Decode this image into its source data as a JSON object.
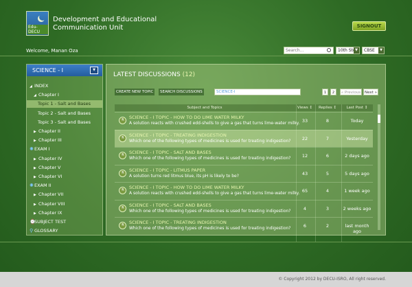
{
  "header": {
    "logo_text": "Edu-DECU",
    "title_line1": "Development and Educational",
    "title_line2": "Communication Unit",
    "signout_label": "SIGNOUT"
  },
  "topbar": {
    "welcome": "Welcome, Manan Oza",
    "search_placeholder": "Search...",
    "std_value": "10th Std",
    "board_value": "CBSE"
  },
  "sidebar": {
    "title": "SCIENCE - I",
    "items": [
      {
        "label": "INDEX",
        "level": 0,
        "icon": "triangle-down",
        "selected": false
      },
      {
        "label": "Chapter I",
        "level": 1,
        "icon": "triangle-down",
        "selected": false
      },
      {
        "label": "Topic 1 - Salt and Bases",
        "level": 2,
        "icon": "",
        "selected": true
      },
      {
        "label": "Topic 2 - Salt and Bases",
        "level": 2,
        "icon": "",
        "selected": false
      },
      {
        "label": "Topic 3 - Salt and Bases",
        "level": 2,
        "icon": "",
        "selected": false
      },
      {
        "label": "Chapter II",
        "level": 1,
        "icon": "triangle-right",
        "selected": false
      },
      {
        "label": "Chapter III",
        "level": 1,
        "icon": "triangle-right",
        "selected": false
      },
      {
        "label": "EXAM I",
        "level": 0,
        "icon": "sun",
        "selected": false
      },
      {
        "label": "Chapter IV",
        "level": 1,
        "icon": "triangle-right",
        "selected": false
      },
      {
        "label": "Chapter V",
        "level": 1,
        "icon": "triangle-right",
        "selected": false
      },
      {
        "label": "Chapter VI",
        "level": 1,
        "icon": "triangle-right",
        "selected": false
      },
      {
        "label": "EXAM II",
        "level": 0,
        "icon": "sun",
        "selected": false
      },
      {
        "label": "Chapter VII",
        "level": 1,
        "icon": "triangle-right",
        "selected": false
      },
      {
        "label": "Chapter VIII",
        "level": 1,
        "icon": "triangle-right",
        "selected": false
      },
      {
        "label": "Chapter IX",
        "level": 1,
        "icon": "triangle-right",
        "selected": false
      },
      {
        "label": "SUBJECT TEST",
        "level": 0,
        "icon": "clock",
        "selected": false
      },
      {
        "label": "GLOSSARY",
        "level": 0,
        "icon": "magnifier",
        "selected": false
      }
    ]
  },
  "main": {
    "title": "LATEST DISCUSSIONS",
    "count": "(12)",
    "create_label": "CREATE NEW TOPIC",
    "search_label": "SEARCH DISCUSSIONS",
    "search_value": "SCIENCE-I",
    "pages": [
      "1",
      "2"
    ],
    "prev_label": "« Previous",
    "next_label": "Next »",
    "columns": [
      "Subject and Topics",
      "Views ↕",
      "Replies ↕",
      "Last Post ↕"
    ],
    "rows": [
      {
        "title": "SCIENCE - I   TOPIC - HOW TO DO LIME WATER MILKY",
        "desc": "A solution reacts with crushed edd-shells to give a gas that turns lime-water milky.",
        "views": "33",
        "replies": "8",
        "last": "Today",
        "highlight": false
      },
      {
        "title": "SCIENCE - I   TOPIC - TREATING INDIGESTION",
        "desc": "Which one of the following types of medicines is used for treating indigestion?",
        "views": "22",
        "replies": "7",
        "last": "Yesterday",
        "highlight": true
      },
      {
        "title": "SCIENCE - I   TOPIC - SALT AND BASES",
        "desc": "Which one of the following types of medicines is used for treating indigestion?",
        "views": "12",
        "replies": "6",
        "last": "2 days ago",
        "highlight": false
      },
      {
        "title": "SCIENCE - I   TOPIC - LITMUS PAPER",
        "desc": "A solution turns red litmus blue, its pH is likely to be?",
        "views": "43",
        "replies": "5",
        "last": "5 days ago",
        "highlight": false
      },
      {
        "title": "SCIENCE - I   TOPIC - HOW TO DO LIME WATER MILKY",
        "desc": "A solution reacts with crushed edd-shells to give a gas that turns lime-water milky.",
        "views": "65",
        "replies": "4",
        "last": "1 week ago",
        "highlight": false
      },
      {
        "title": "SCIENCE - I   TOPIC - SALT AND BASES",
        "desc": "Which one of the following types of medicines is used for treating indigestion?",
        "views": "4",
        "replies": "3",
        "last": "2 weeks ago",
        "highlight": false
      },
      {
        "title": "SCIENCE - I   TOPIC - TREATING INDIGESTION",
        "desc": "Which one of the following types of medicines is used for treating indigestion?",
        "views": "6",
        "replies": "2",
        "last": "last month ago",
        "highlight": false
      }
    ]
  },
  "footer": {
    "copyright": "© Copyright 2012 by DECU-ISRO, All right reserved."
  }
}
